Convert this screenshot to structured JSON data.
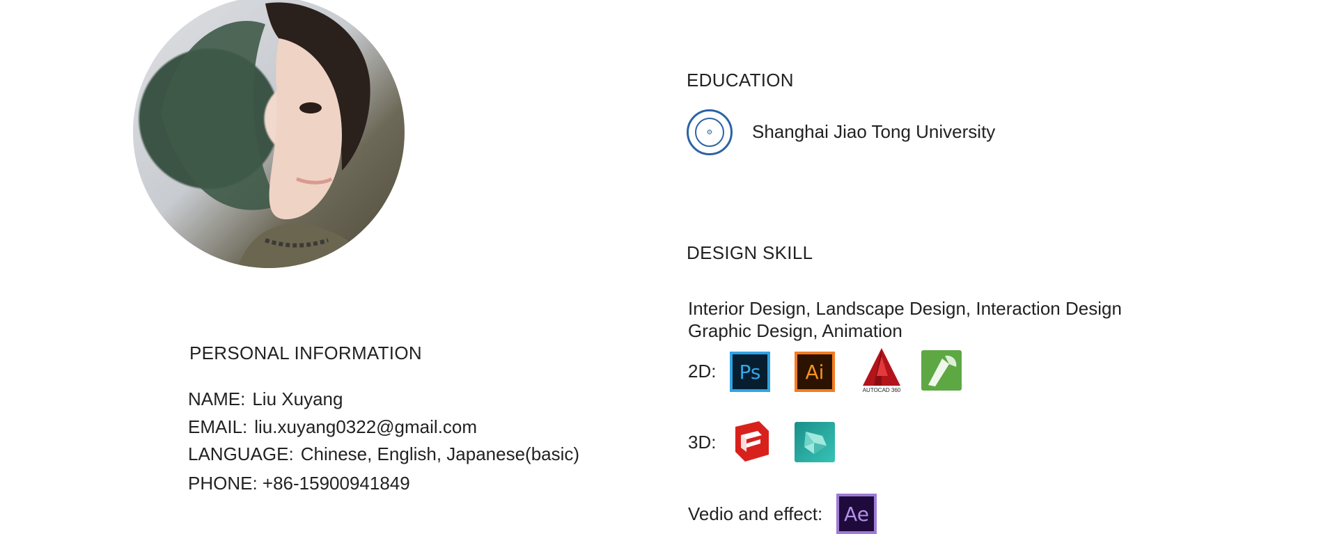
{
  "personal": {
    "title": "PERSONAL INFORMATION",
    "name_label": "NAME:",
    "name_value": "Liu Xuyang",
    "email_label": "EMAIL:",
    "email_value": "liu.xuyang0322@gmail.com",
    "language_label": "LANGUAGE:",
    "language_value": "Chinese, English, Japanese(basic)",
    "phone_line": "PHONE: +86-15900941849"
  },
  "education": {
    "title": "EDUCATION",
    "university": "Shanghai Jiao Tong University"
  },
  "design_skill": {
    "title": "DESIGN SKILL",
    "line1": "Interior Design, Landscape Design, Interaction Design",
    "line2": "Graphic Design, Animation",
    "row_2d_label": "2D:",
    "row_3d_label": "3D:",
    "row_video_label": "Vedio and effect:",
    "icons": {
      "ps": "Ps",
      "ai": "Ai",
      "autocad": "AUTOCAD 360",
      "ae": "Ae"
    }
  }
}
